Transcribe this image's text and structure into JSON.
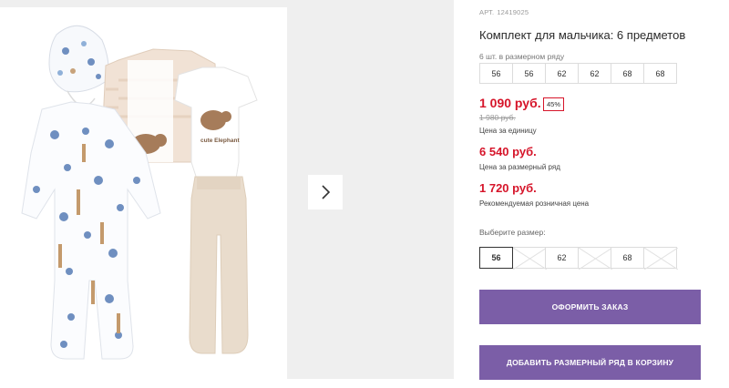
{
  "gallery": {
    "photo_alt": "product-photo",
    "next_icon": "chevron-right-icon"
  },
  "product": {
    "art_label": "АРТ.",
    "art_number": "12419025",
    "title": "Комплект для мальчика: 6 предметов",
    "print_text": "cute Elephant"
  },
  "size_range": {
    "caption": "6 шт. в размерном ряду",
    "sizes": [
      "56",
      "56",
      "62",
      "62",
      "68",
      "68"
    ]
  },
  "prices": {
    "current": "1 090 руб.",
    "discount": "45%",
    "old": "1 980 руб.",
    "unit_note": "Цена за единицу",
    "total": "6 540 руб.",
    "total_note": "Цена за размерный ряд",
    "retail": "1 720 руб.",
    "retail_note": "Рекомендуемая розничная цена"
  },
  "size_select": {
    "label": "Выберите размер:",
    "options": [
      {
        "value": "56",
        "state": "selected"
      },
      {
        "value": "",
        "state": "unavailable"
      },
      {
        "value": "62",
        "state": "available"
      },
      {
        "value": "",
        "state": "unavailable"
      },
      {
        "value": "68",
        "state": "available"
      },
      {
        "value": "",
        "state": "unavailable"
      }
    ]
  },
  "buttons": {
    "order": "Оформить заказ",
    "add_range": "Добавить размерный ряд в корзину"
  },
  "colors": {
    "price_red": "#d6152a",
    "button_purple": "#7b5ea7",
    "gallery_bg": "#efefef"
  }
}
